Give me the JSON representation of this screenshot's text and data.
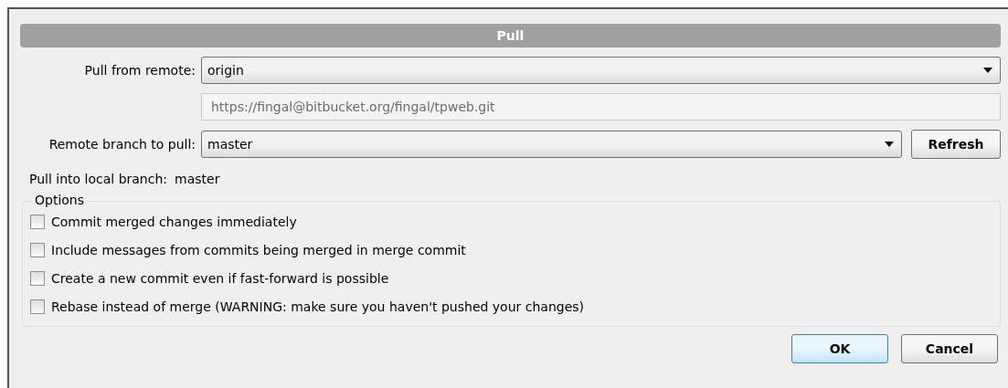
{
  "window": {
    "title": "Pull"
  },
  "remote": {
    "label": "Pull from remote:",
    "value": "origin",
    "url": "https://fingal@bitbucket.org/fingal/tpweb.git"
  },
  "branch": {
    "label": "Remote branch to pull:",
    "value": "master",
    "refresh": "Refresh"
  },
  "local": {
    "label": "Pull into local branch:",
    "value": "master"
  },
  "options": {
    "title": "Options",
    "items": [
      {
        "label": "Commit merged changes immediately",
        "checked": false
      },
      {
        "label": "Include messages from commits being merged in merge commit",
        "checked": false
      },
      {
        "label": "Create a new commit even if fast-forward is possible",
        "checked": false
      },
      {
        "label": "Rebase instead of merge (WARNING: make sure you haven't pushed your changes)",
        "checked": false
      }
    ]
  },
  "buttons": [
    {
      "label": "OK",
      "default": true
    },
    {
      "label": "Cancel",
      "default": false
    }
  ]
}
